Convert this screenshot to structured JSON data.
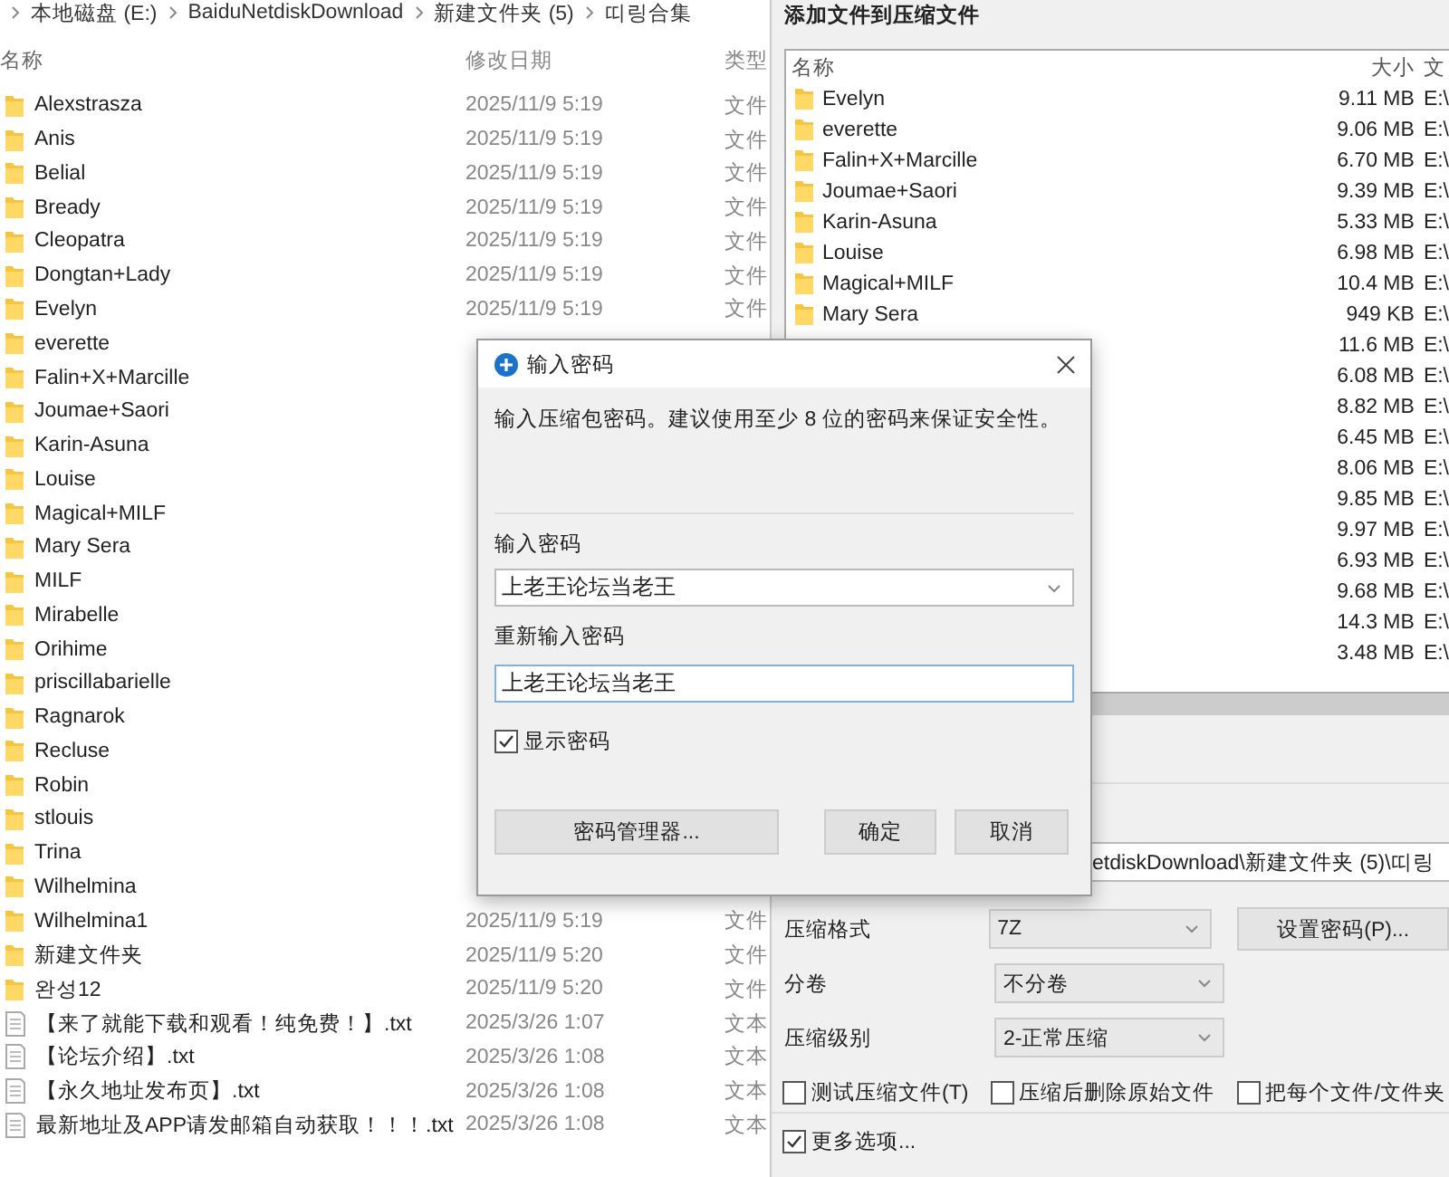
{
  "explorer": {
    "breadcrumb": [
      "本地磁盘 (E:)",
      "BaiduNetdiskDownload",
      "新建文件夹 (5)",
      "띠링合集"
    ],
    "columns": [
      "名称",
      "修改日期",
      "类型"
    ],
    "rows": [
      {
        "kind": "folder",
        "name": "Alexstrasza",
        "modified": "2025/11/9 5:19",
        "type": "文件"
      },
      {
        "kind": "folder",
        "name": "Anis",
        "modified": "2025/11/9 5:19",
        "type": "文件"
      },
      {
        "kind": "folder",
        "name": "Belial",
        "modified": "2025/11/9 5:19",
        "type": "文件"
      },
      {
        "kind": "folder",
        "name": "Bready",
        "modified": "2025/11/9 5:19",
        "type": "文件"
      },
      {
        "kind": "folder",
        "name": "Cleopatra",
        "modified": "2025/11/9 5:19",
        "type": "文件"
      },
      {
        "kind": "folder",
        "name": "Dongtan+Lady",
        "modified": "2025/11/9 5:19",
        "type": "文件"
      },
      {
        "kind": "folder",
        "name": "Evelyn",
        "modified": "2025/11/9 5:19",
        "type": "文件"
      },
      {
        "kind": "folder",
        "name": "everette"
      },
      {
        "kind": "folder",
        "name": "Falin+X+Marcille"
      },
      {
        "kind": "folder",
        "name": "Joumae+Saori"
      },
      {
        "kind": "folder",
        "name": "Karin-Asuna"
      },
      {
        "kind": "folder",
        "name": "Louise"
      },
      {
        "kind": "folder",
        "name": "Magical+MILF"
      },
      {
        "kind": "folder",
        "name": "Mary Sera"
      },
      {
        "kind": "folder",
        "name": "MILF"
      },
      {
        "kind": "folder",
        "name": "Mirabelle"
      },
      {
        "kind": "folder",
        "name": "Orihime"
      },
      {
        "kind": "folder",
        "name": "priscillabarielle"
      },
      {
        "kind": "folder",
        "name": "Ragnarok"
      },
      {
        "kind": "folder",
        "name": "Recluse"
      },
      {
        "kind": "folder",
        "name": "Robin"
      },
      {
        "kind": "folder",
        "name": "stlouis"
      },
      {
        "kind": "folder",
        "name": "Trina"
      },
      {
        "kind": "folder",
        "name": "Wilhelmina"
      },
      {
        "kind": "folder",
        "name": "Wilhelmina1",
        "modified": "2025/11/9 5:19",
        "type": "文件"
      },
      {
        "kind": "folder",
        "name": "新建文件夹",
        "modified": "2025/11/9 5:20",
        "type": "文件"
      },
      {
        "kind": "folder",
        "name": "완성12",
        "modified": "2025/11/9 5:20",
        "type": "文件"
      },
      {
        "kind": "file",
        "name": "【来了就能下载和观看！纯免费！】.txt",
        "modified": "2025/3/26 1:07",
        "type": "文本"
      },
      {
        "kind": "file",
        "name": "【论坛介绍】.txt",
        "modified": "2025/3/26 1:08",
        "type": "文本"
      },
      {
        "kind": "file",
        "name": "【永久地址发布页】.txt",
        "modified": "2025/3/26 1:08",
        "type": "文本"
      },
      {
        "kind": "file",
        "name": "最新地址及APP请发邮箱自动获取！！！.txt",
        "modified": "2025/3/26 1:08",
        "type": "文本"
      }
    ]
  },
  "archive_window": {
    "title": "添加文件到压缩文件",
    "columns": [
      "名称",
      "大小",
      "文"
    ],
    "rows": [
      {
        "name": "Evelyn",
        "size": "9.11 MB",
        "path": "E:\\"
      },
      {
        "name": "everette",
        "size": "9.06 MB",
        "path": "E:\\"
      },
      {
        "name": "Falin+X+Marcille",
        "size": "6.70 MB",
        "path": "E:\\"
      },
      {
        "name": "Joumae+Saori",
        "size": "9.39 MB",
        "path": "E:\\"
      },
      {
        "name": "Karin-Asuna",
        "size": "5.33 MB",
        "path": "E:\\"
      },
      {
        "name": "Louise",
        "size": "6.98 MB",
        "path": "E:\\"
      },
      {
        "name": "Magical+MILF",
        "size": "10.4 MB",
        "path": "E:\\"
      },
      {
        "name": "Mary Sera",
        "size": "949 KB",
        "path": "E:\\"
      },
      {
        "size": "11.6 MB",
        "path": "E:\\"
      },
      {
        "size": "6.08 MB",
        "path": "E:\\"
      },
      {
        "size": "8.82 MB",
        "path": "E:\\"
      },
      {
        "size": "6.45 MB",
        "path": "E:\\"
      },
      {
        "size": "8.06 MB",
        "path": "E:\\"
      },
      {
        "size": "9.85 MB",
        "path": "E:\\"
      },
      {
        "size": "9.97 MB",
        "path": "E:\\"
      },
      {
        "size": "6.93 MB",
        "path": "E:\\"
      },
      {
        "size": "9.68 MB",
        "path": "E:\\"
      },
      {
        "size": "14.3 MB",
        "path": "E:\\"
      },
      {
        "size": "3.48 MB",
        "path": "E:\\"
      }
    ],
    "output_path": "etdiskDownload\\新建文件夹 (5)\\띠링",
    "settings": [
      {
        "label": "压缩格式",
        "value": "7Z",
        "button": "设置密码(P)..."
      },
      {
        "label": "分卷",
        "value": "不分卷"
      },
      {
        "label": "压缩级别",
        "value": "2-正常压缩"
      }
    ],
    "options": [
      {
        "label": "测试压缩文件(T)",
        "checked": false
      },
      {
        "label": "压缩后删除原始文件",
        "checked": false
      },
      {
        "label": "把每个文件/文件夹",
        "checked": false
      }
    ],
    "more_options": {
      "label": "更多选项...",
      "checked": true
    }
  },
  "password_dialog": {
    "title": "输入密码",
    "message": "输入压缩包密码。建议使用至少 8 位的密码来保证安全性。",
    "password_label": "输入密码",
    "password_value": "上老王论坛当老王",
    "confirm_label": "重新输入密码",
    "confirm_value": "上老王论坛当老王",
    "show_password": {
      "label": "显示密码",
      "checked": true
    },
    "buttons": [
      "密码管理器...",
      "确定",
      "取消"
    ]
  }
}
